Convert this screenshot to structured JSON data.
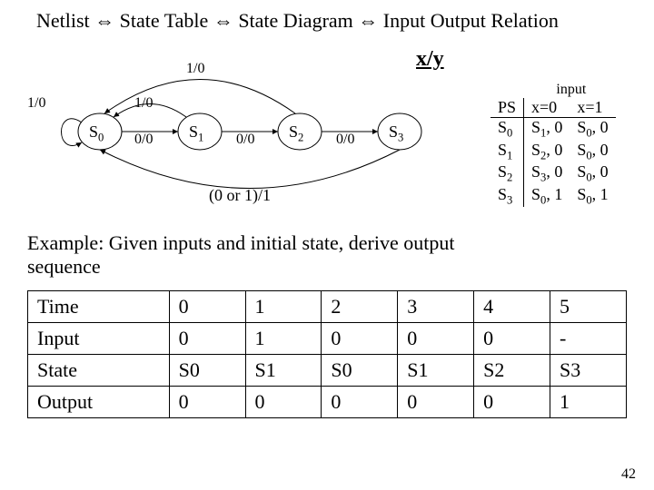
{
  "title_parts": [
    "Netlist",
    "State Table",
    "State Diagram",
    "Input Output Relation"
  ],
  "arrow_sep": "⇔",
  "xy_label": "x/y",
  "diagram": {
    "states": [
      "S0",
      "S1",
      "S2",
      "S3"
    ],
    "edge_top_outer": "1/0",
    "edge_s0_s1_top": "1/0",
    "edge_s0_s1_bot": "0/0",
    "edge_s1_s2": "0/0",
    "edge_s2_s3": "0/0",
    "loop_left": "1/0",
    "bottom_return": "(0 or 1)/1"
  },
  "example_text": "Example: Given inputs and initial state, derive output sequence",
  "state_table": {
    "input_label": "input",
    "ps_label": "PS",
    "cols": [
      "x=0",
      "x=1"
    ],
    "rows": [
      {
        "ps": "S0",
        "c0": "S1, 0",
        "c1": "S0, 0"
      },
      {
        "ps": "S1",
        "c0": "S2, 0",
        "c1": "S0, 0"
      },
      {
        "ps": "S2",
        "c0": "S3, 0",
        "c1": "S0, 0"
      },
      {
        "ps": "S3",
        "c0": "S0, 1",
        "c1": "S0, 1"
      }
    ]
  },
  "time_table": {
    "row_labels": [
      "Time",
      "Input",
      "State",
      "Output"
    ],
    "cols": [
      "0",
      "1",
      "2",
      "3",
      "4",
      "5"
    ],
    "input": [
      "0",
      "1",
      "0",
      "0",
      "0",
      "-"
    ],
    "state": [
      "S0",
      "S1",
      "S0",
      "S1",
      "S2",
      "S3"
    ],
    "output": [
      "0",
      "0",
      "0",
      "0",
      "0",
      "1"
    ]
  },
  "page_number": "42"
}
